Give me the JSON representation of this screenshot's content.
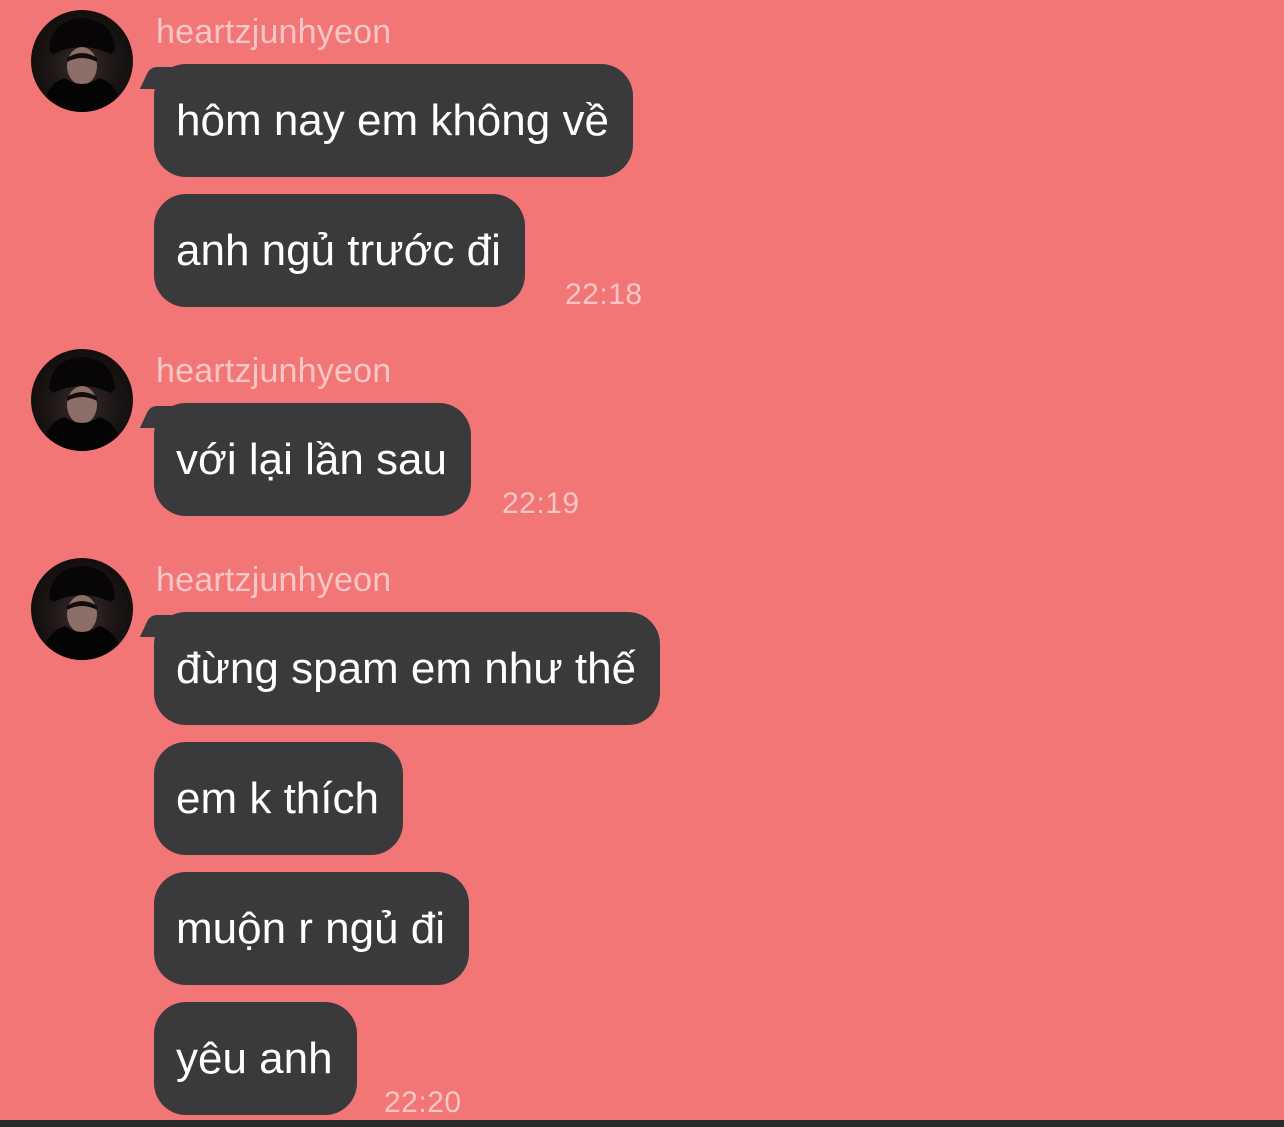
{
  "colors": {
    "background": "#F27676",
    "bubble": "#3A3A3C",
    "bubble_text": "#FFFFFF",
    "meta_text": "#F9C6C6"
  },
  "groups": [
    {
      "username": "heartzjunhyeon",
      "avatar_icon": "profile-photo",
      "messages": [
        "hôm nay em không về",
        "anh ngủ trước đi"
      ],
      "time": "22:18"
    },
    {
      "username": "heartzjunhyeon",
      "avatar_icon": "profile-photo",
      "messages": [
        "với lại lần sau"
      ],
      "time": "22:19"
    },
    {
      "username": "heartzjunhyeon",
      "avatar_icon": "profile-photo",
      "messages": [
        "đừng spam em như thế",
        "em k thích",
        "muộn r ngủ đi",
        "yêu anh"
      ],
      "time": "22:20"
    }
  ]
}
